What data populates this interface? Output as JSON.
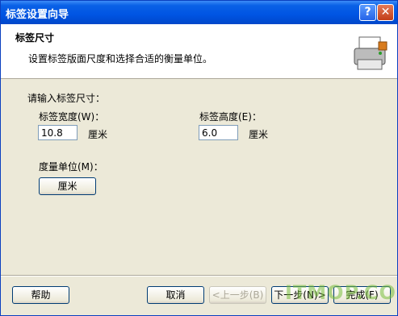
{
  "titlebar": {
    "title": "标签设置向导",
    "help_label": "?",
    "close_label": "✕"
  },
  "header": {
    "title": "标签尺寸",
    "subtitle": "设置标签版面尺度和选择合适的衡量单位。"
  },
  "form": {
    "prompt": "请输入标签尺寸：",
    "width_label": "标签宽度(W)：",
    "width_value": "10.8",
    "width_unit": "厘米",
    "height_label": "标签高度(E)：",
    "height_value": "6.0",
    "height_unit": "厘米",
    "unit_label": "度量单位(M)：",
    "unit_button": "厘米"
  },
  "footer": {
    "help": "帮助",
    "cancel": "取消",
    "back": "<上一步(B)",
    "next": "下一步(N)>",
    "finish": "完成(F)"
  },
  "watermark": "ITMOP.COM"
}
